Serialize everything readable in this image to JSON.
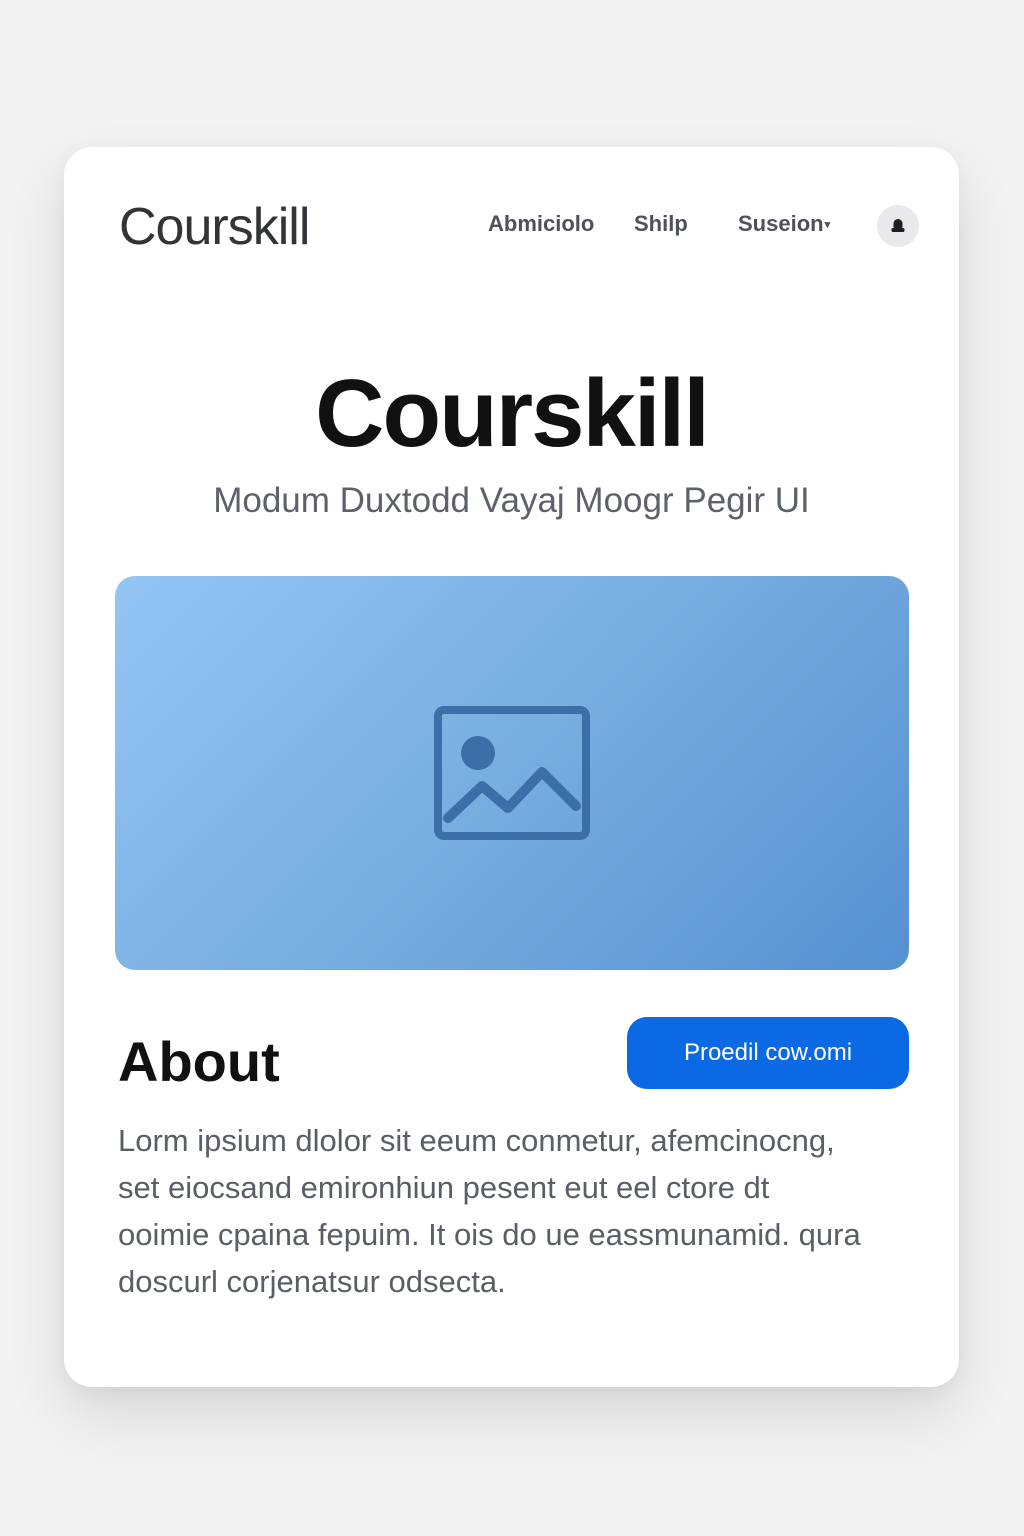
{
  "header": {
    "logo": "Courskill",
    "nav": [
      {
        "label": "Abmiciolo"
      },
      {
        "label": "Shilp"
      },
      {
        "label": "Suseion",
        "caret": "▾"
      }
    ],
    "avatar_icon": "user-icon"
  },
  "hero": {
    "title": "Courskill",
    "subtitle": "Modum Duxtodd Vayaj Moogr Pegir UI"
  },
  "media": {
    "icon": "image-icon",
    "colors": [
      "#94c5f5",
      "#5691d2"
    ]
  },
  "about": {
    "title": "About",
    "button_label": "Proedil cow.omi",
    "lines": [
      "Lorm ipsium dlolor sit eeum conmetur, afemcinocng,",
      "set eiocsand emironhiun pesent eut eel ctore dt",
      "ooimie cpaina fepuim. It ois do ue eassmunamid. qura",
      "doscurl corjenatsur odsecta."
    ]
  },
  "colors": {
    "accent": "#0b69e3",
    "background": "#f2f2f3",
    "card": "#ffffff"
  }
}
